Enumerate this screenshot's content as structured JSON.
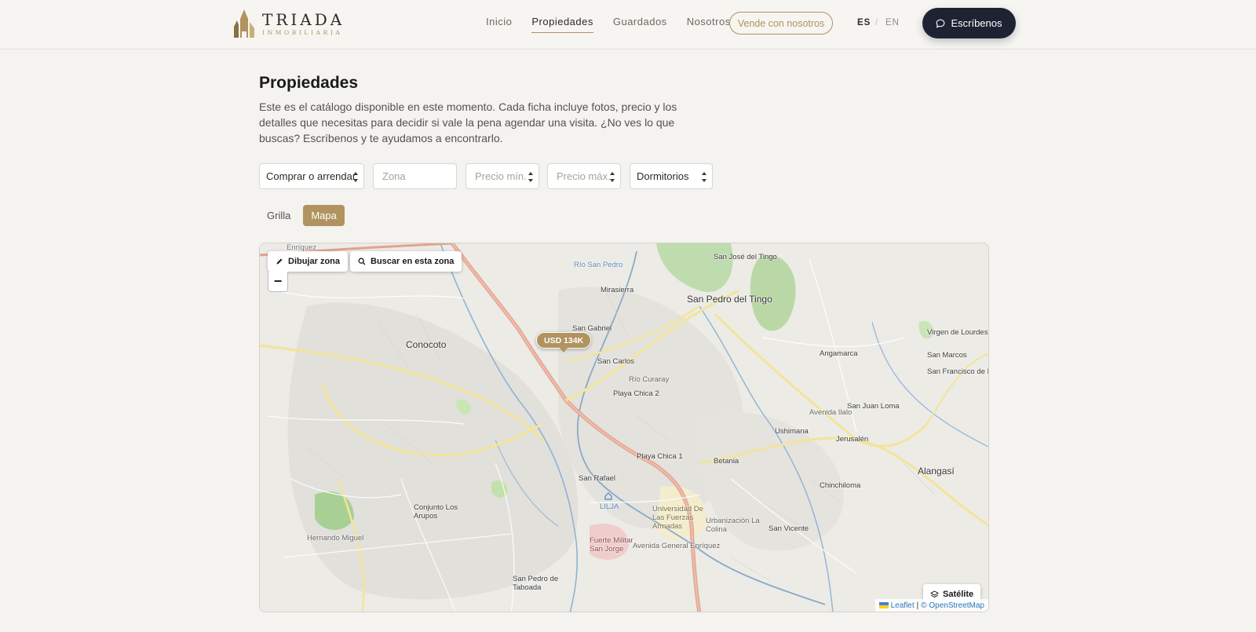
{
  "header": {
    "logo_name": "TRIADA",
    "logo_sub": "INMOBILIARIA",
    "nav": [
      {
        "label": "Inicio"
      },
      {
        "label": "Propiedades"
      },
      {
        "label": "Guardados"
      },
      {
        "label": "Nosotros"
      }
    ],
    "sell_label": "Vende con nosotros",
    "lang_es": "ES",
    "lang_sep": "/",
    "lang_en": "EN",
    "write_label": "Escríbenos",
    "colors": {
      "accent": "#b0935f",
      "dark": "#1d2333"
    }
  },
  "main": {
    "title": "Propiedades",
    "intro": "Este es el catálogo disponible en este momento. Cada ficha incluye fotos, precio y los detalles que necesitas para decidir si vale la pena agendar una visita. ¿No ves lo que buscas? Escríbenos y te ayudamos a encontrarlo.",
    "filters": {
      "operation": "Comprar o arrendar",
      "zone_placeholder": "Zona",
      "price_min_placeholder": "Precio mín.",
      "price_max_placeholder": "Precio máx.",
      "bedrooms": "Dormitorios"
    },
    "views": {
      "grid": "Grilla",
      "map": "Mapa",
      "active": "Mapa"
    }
  },
  "map": {
    "draw_zone": "Dibujar zona",
    "search_area": "Buscar en esta zona",
    "zoom_out": "−",
    "marker_price": "USD 134K",
    "satellite": "Satélite",
    "attribution_leaflet": "Leaflet",
    "attribution_sep": "|",
    "attribution_osm": "© OpenStreetMap",
    "places": {
      "conocoto": "Conocoto",
      "san_jose_del_tingo": "San José del Tingo",
      "mirasierra": "Mirasierra",
      "san_pedro_del_tingo": "San Pedro del Tingo",
      "san_gabriel": "San Gabriel",
      "virgen_de_lourdes": "Virgen de Lourdes",
      "angamarca": "Angamarca",
      "san_marcos": "San Marcos",
      "san_carlos": "San Carlos",
      "san_francisco_de_banos": "San Francisco de Baños",
      "playa_chica_2": "Playa Chica 2",
      "san_juan_loma": "San Juan Loma",
      "ushimana": "Ushimana",
      "jerusalen": "Jerusalén",
      "playa_chica_1": "Playa Chica 1",
      "betania": "Betania",
      "alangasi": "Alangasí",
      "san_rafael": "San Rafael",
      "chinchiloma": "Chinchiloma",
      "lilja": "LILJA",
      "conjunto_los_arupos": "Conjunto Los Arupos",
      "universidad": "Universidad De Las Fuerzas Armadas",
      "urbanizacion_la_colina": "Urbanización La Colina",
      "san_vicente": "San Vicente",
      "fuerte_militar": "Fuerte Militar San Jorge",
      "san_pedro_de_taboada": "San Pedro de Taboada",
      "enriquez": "Enríquez",
      "rio_san_pedro": "Río San Pedro",
      "av_ilalo": "Avenida Ilalo",
      "av_general_enriquez": "Avenida General Enríquez",
      "rio_curaray": "Río Curaray",
      "hernando_miguel": "Hernando Miguel"
    }
  }
}
